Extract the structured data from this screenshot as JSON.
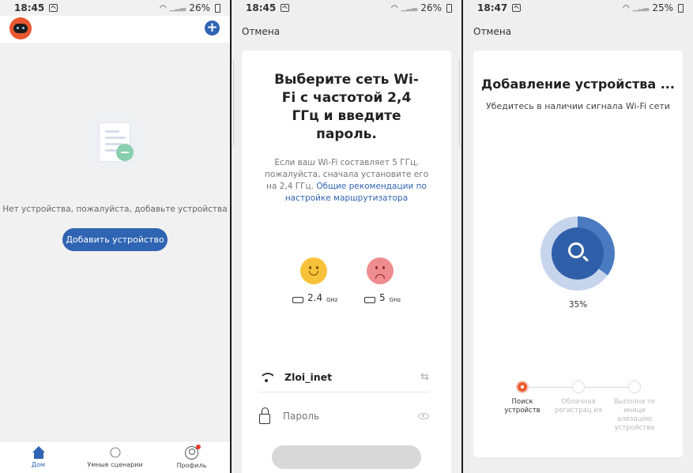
{
  "screen1": {
    "status": {
      "time": "18:45",
      "battery": "26%"
    },
    "empty_text": "Нет устройства, пожалуйста, добавьте устройства",
    "add_device_label": "Добавить устройство",
    "nav": [
      {
        "label": "Дом",
        "icon": "home-icon"
      },
      {
        "label": "Умные сценарии",
        "icon": "sun-icon"
      },
      {
        "label": "Профиль",
        "icon": "profile-icon"
      }
    ]
  },
  "screen2": {
    "status": {
      "time": "18:45",
      "battery": "26%"
    },
    "cancel_label": "Отмена",
    "title": "Выберите сеть Wi-Fi с частотой 2,4 ГГц и введите пароль.",
    "description": "Если ваш Wi-Fi составляет 5 ГГц, пожалуйста, сначала установите его на 2,4 ГГц.",
    "link_text": "Общие рекомендации по настройке маршрутизатора",
    "band_good": {
      "value": "2.4",
      "unit": "GHz"
    },
    "band_bad": {
      "value": "5",
      "unit": "GHz"
    },
    "ssid": "Zloi_inet",
    "password_placeholder": "Пароль"
  },
  "screen3": {
    "status": {
      "time": "18:47",
      "battery": "25%"
    },
    "cancel_label": "Отмена",
    "title": "Добавление устройства ...",
    "subtitle": "Убедитесь в наличии сигнала Wi-Fi сети",
    "progress": 0.35,
    "progress_label": "35%",
    "steps": [
      {
        "label": "Поиск устройств",
        "active": true
      },
      {
        "label": "Облачная регистрац ия",
        "active": false
      },
      {
        "label": "Выполня те иници ализацию устройства",
        "active": false
      }
    ]
  },
  "colors": {
    "primary": "#2f64b2",
    "accent": "#ec5b2f"
  }
}
